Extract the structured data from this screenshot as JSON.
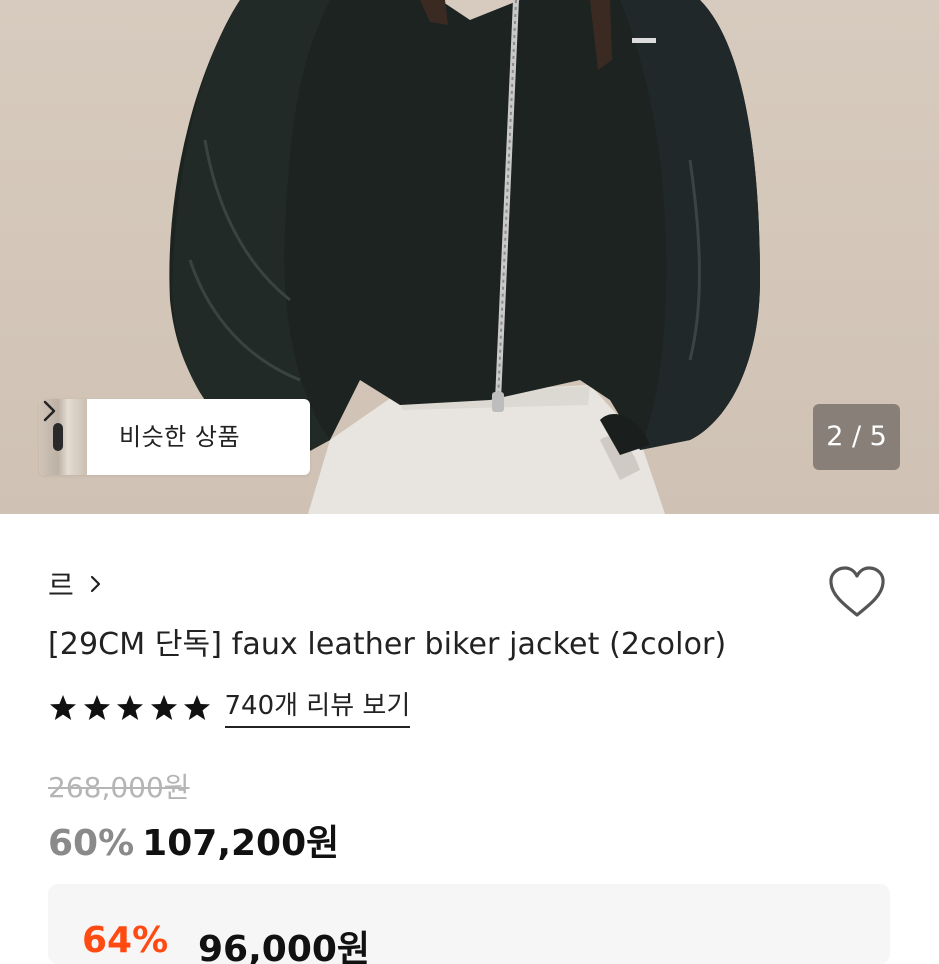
{
  "gallery": {
    "similar_label": "비슷한 상품",
    "counter": "2 / 5"
  },
  "product": {
    "brand": "르",
    "title": "[29CM 단독] faux leather biker jacket (2color)",
    "rating_stars": 5,
    "review_link": "740개 리뷰 보기"
  },
  "price": {
    "original": "268,000원",
    "discount_rate": "60%",
    "sale": "107,200원"
  },
  "coupon": {
    "rate": "64%",
    "price": "96,000원"
  },
  "colors": {
    "coupon_accent": "#ff4a12",
    "discount_gray": "#8a8a8a",
    "strikethrough_gray": "#b5b5b5"
  },
  "icons": [
    "chevron-right-icon",
    "heart-outline-icon",
    "star-icon"
  ]
}
